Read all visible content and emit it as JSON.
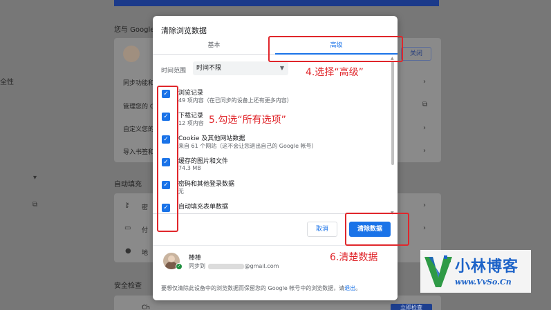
{
  "background": {
    "heading_google": "您与 Google",
    "side_label_1": "全性",
    "close_button": "关闭",
    "rows": [
      "同步功能和",
      "管理您的 G",
      "自定义您的",
      "导入书签和"
    ],
    "heading_autofill": "自动填充",
    "autofill_rows": [
      "密",
      "付",
      "地"
    ],
    "heading_safety": "安全检查",
    "safety_row": "Ch",
    "safety_row_2": "安全检查",
    "safety_button": "立即检查"
  },
  "dialog": {
    "title": "清除浏览数据",
    "tabs": [
      {
        "label": "基本"
      },
      {
        "label": "高级"
      }
    ],
    "time_range_label": "时间范围",
    "time_range_value": "时间不限",
    "items": [
      {
        "title": "浏览记录",
        "subtitle": "49 项内容（在已同步的设备上还有更多内容）",
        "checked": true
      },
      {
        "title": "下载记录",
        "subtitle": "12 项内容",
        "checked": true
      },
      {
        "title": "Cookie 及其他网站数据",
        "subtitle": "来自 61 个网站（这不会让您退出自己的 Google 帐号）",
        "checked": true
      },
      {
        "title": "缓存的图片和文件",
        "subtitle": "74.3 MB",
        "checked": true
      },
      {
        "title": "密码和其他登录数据",
        "subtitle": "无",
        "checked": true
      },
      {
        "title": "自动填充表单数据",
        "subtitle": "",
        "checked": true
      }
    ],
    "cancel_label": "取消",
    "clear_label": "清除数据",
    "account_name": "棒棒",
    "sync_prefix": "同步到",
    "sync_suffix": "@gmail.com",
    "note_text": "要想仅清除此设备中的浏览数据而保留您的 Google 帐号中的浏览数据，请",
    "note_link": "退出",
    "note_end": "。"
  },
  "annotations": {
    "step4": "4.选择“高级”",
    "step5": "5.勾选“所有选项”",
    "step6": "6.清楚数据"
  },
  "watermark": {
    "title": "小林博客",
    "url": "www.VvSo.Cn"
  },
  "colors": {
    "accent": "#1a73e8",
    "annotation": "#e0262b",
    "watermark": "#1d63c8"
  }
}
